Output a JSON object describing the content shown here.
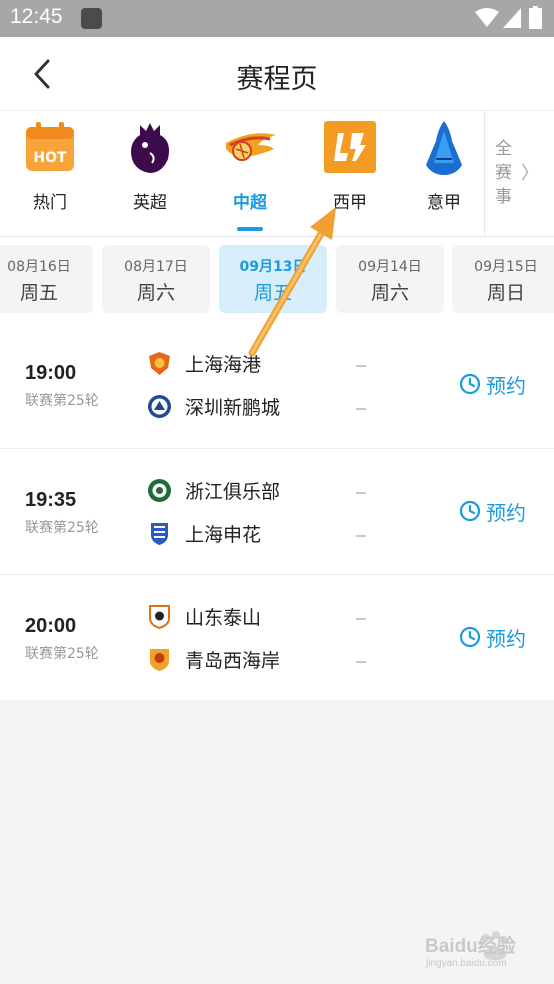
{
  "status_bar": {
    "time": "12:45"
  },
  "header": {
    "title": "赛程页"
  },
  "leagues": [
    {
      "label": "热门",
      "icon": "hot-calendar-icon",
      "active": false
    },
    {
      "label": "英超",
      "icon": "premier-league-lion-icon",
      "active": false
    },
    {
      "label": "中超",
      "icon": "csl-ball-icon",
      "active": true
    },
    {
      "label": "西甲",
      "icon": "laliga-icon",
      "active": false
    },
    {
      "label": "意甲",
      "icon": "serie-a-icon",
      "active": false
    }
  ],
  "all_events": {
    "label": "全赛事"
  },
  "dates": [
    {
      "date": "08月16日",
      "weekday": "周五",
      "active": false
    },
    {
      "date": "08月17日",
      "weekday": "周六",
      "active": false
    },
    {
      "date": "09月13日",
      "weekday": "周五",
      "active": true
    },
    {
      "date": "09月14日",
      "weekday": "周六",
      "active": false
    },
    {
      "date": "09月15日",
      "weekday": "周日",
      "active": false
    }
  ],
  "matches": [
    {
      "time": "19:00",
      "round": "联赛第25轮",
      "home": "上海海港",
      "away": "深圳新鹏城",
      "home_score": "-",
      "away_score": "-",
      "action": "预约"
    },
    {
      "time": "19:35",
      "round": "联赛第25轮",
      "home": "浙江俱乐部",
      "away": "上海申花",
      "home_score": "-",
      "away_score": "-",
      "action": "预约"
    },
    {
      "time": "20:00",
      "round": "联赛第25轮",
      "home": "山东泰山",
      "away": "青岛西海岸",
      "home_score": "-",
      "away_score": "-",
      "action": "预约"
    }
  ],
  "colors": {
    "accent": "#1a9be0",
    "annotation_arrow": "#f0a030",
    "active_date_bg": "#d5eefa"
  },
  "watermark": {
    "text": "Baidu经验",
    "url": "jingyan.baidu.com"
  }
}
